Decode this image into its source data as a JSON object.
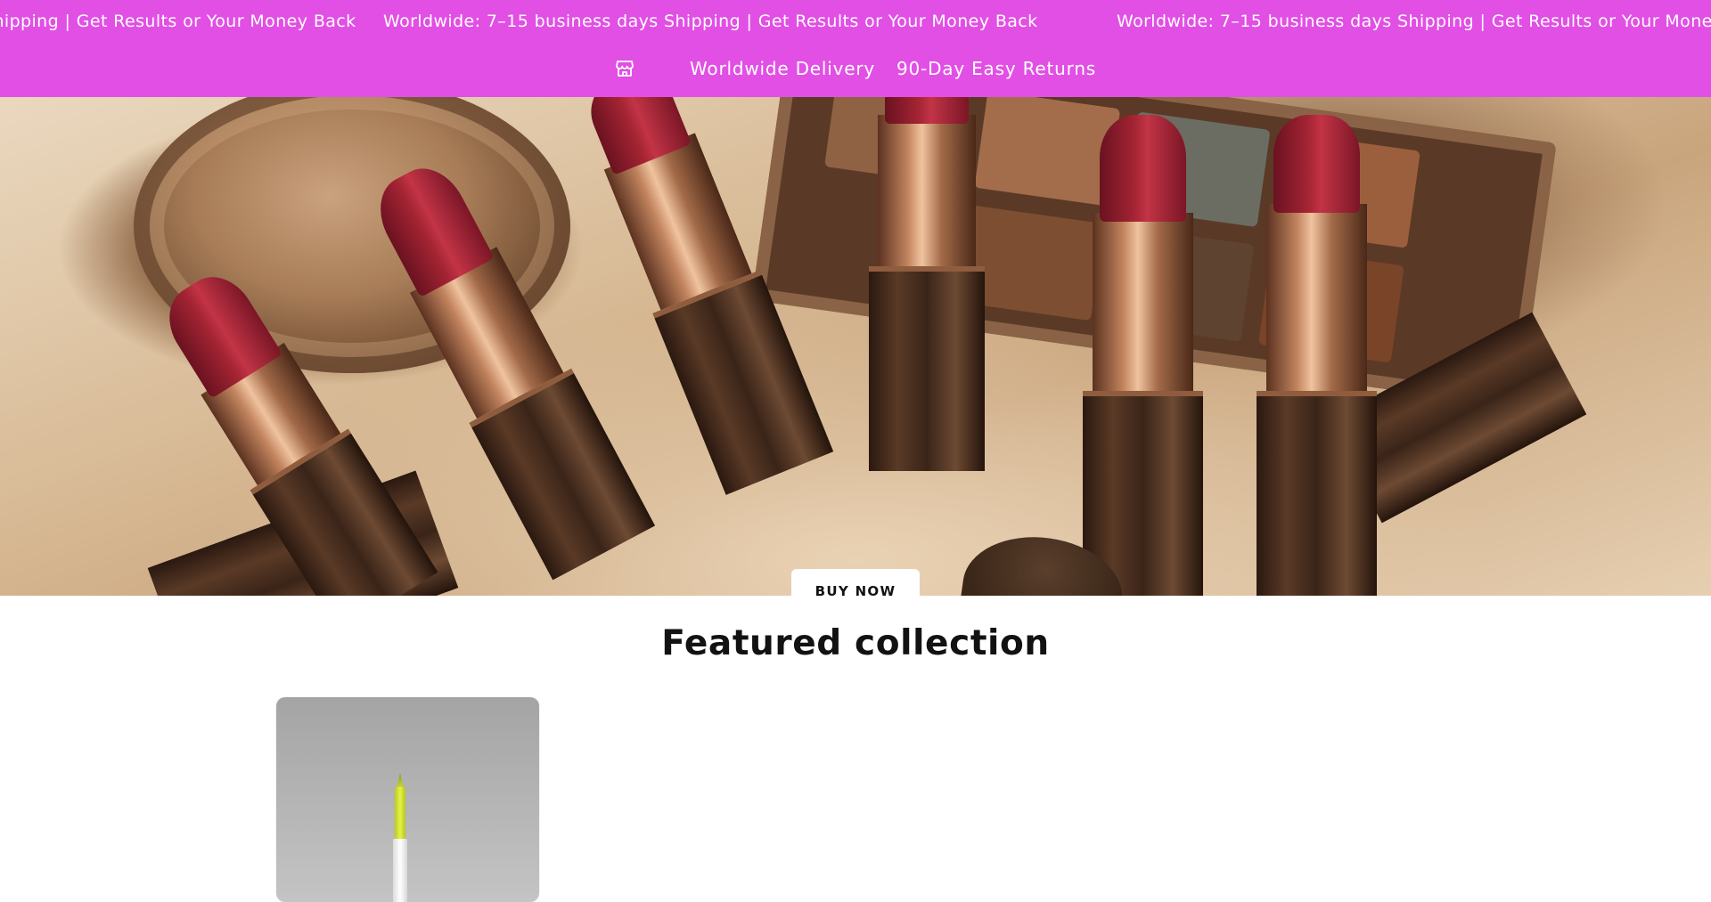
{
  "announcement_bar": {
    "background_color": "#e24fe5",
    "marquee_items": [
      "Worldwide: 7–15 business days Shipping | Get Results or Your Money Back",
      "Worldwide: 7–15 business days Shipping | Get Results or Your Money Back",
      "Worldwide: 7–15 business days Shipping | Get Results or Your Money Back"
    ],
    "usp_icon": "store-icon",
    "usp_items": [
      "Worldwide Delivery",
      "90-Day Easy Returns"
    ]
  },
  "hero": {
    "image": "lipsticks-and-eyeshadow-palette-photo",
    "button_label": "BUY NOW"
  },
  "featured_collection": {
    "title": "Featured collection",
    "products": [
      {
        "image": "yellow-lip-liner-pencil-photo"
      }
    ]
  }
}
